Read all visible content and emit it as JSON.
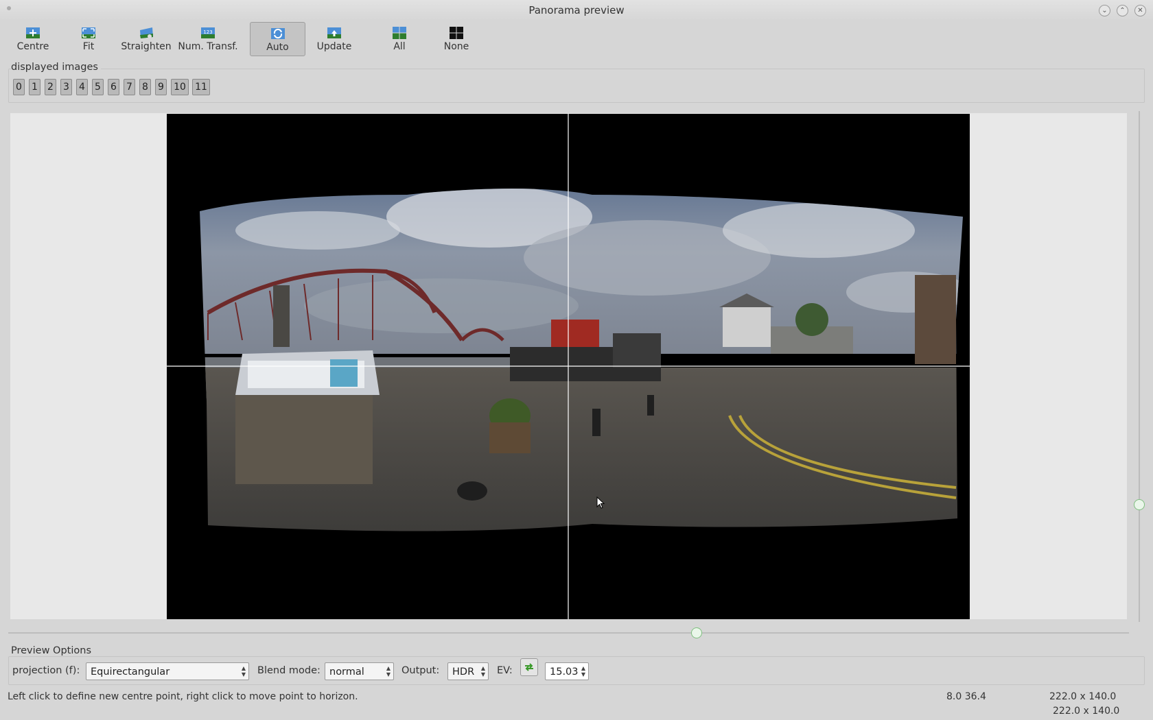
{
  "window": {
    "title": "Panorama preview"
  },
  "toolbar": {
    "centre": "Centre",
    "fit": "Fit",
    "straighten": "Straighten",
    "num_transf": "Num. Transf.",
    "auto": "Auto",
    "update": "Update",
    "all": "All",
    "none": "None"
  },
  "displayed_images": {
    "label": "displayed images",
    "buttons": [
      "0",
      "1",
      "2",
      "3",
      "4",
      "5",
      "6",
      "7",
      "8",
      "9",
      "10",
      "11"
    ]
  },
  "preview_options": {
    "label": "Preview Options",
    "projection_label": "projection (f):",
    "projection_value": "Equirectangular",
    "blend_label": "Blend mode:",
    "blend_value": "normal",
    "output_label": "Output:",
    "output_value": "HDR",
    "ev_label": "EV:",
    "ev_value": "15.03"
  },
  "status": {
    "hint": "Left click to define new centre point, right click to move point to horizon.",
    "coords": "8.0 36.4",
    "fov": "222.0 x 140.0",
    "fov2": "222.0 x 140.0"
  }
}
